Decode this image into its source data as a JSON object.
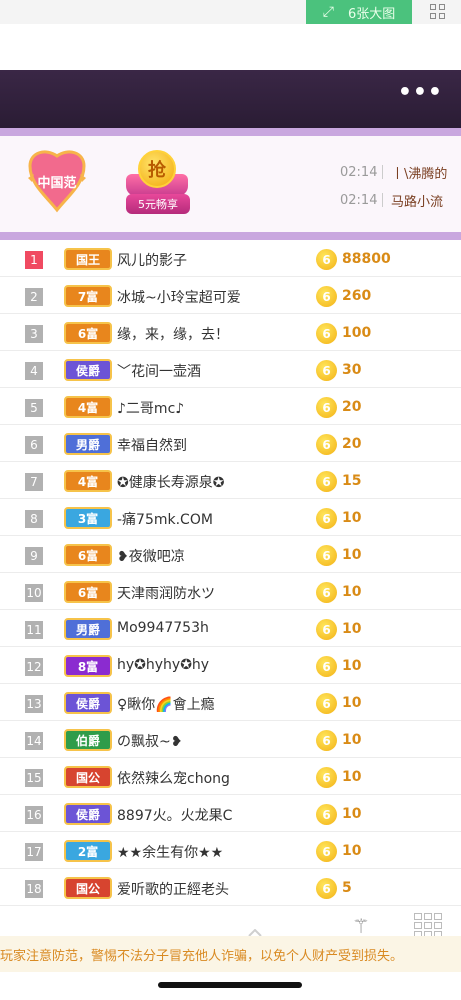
{
  "top": {
    "label": "6张大图",
    "expand_icon": "expand-arrows-icon",
    "grid_icon": "grid-icon"
  },
  "header": {
    "more_icon": "more-dots-icon",
    "more_symbol": "•••"
  },
  "banner": {
    "badge_text": "中国范",
    "grab_char": "抢",
    "grab_label": "5元畅享",
    "news": [
      {
        "time": "02:14",
        "text": "丨\\沸腾的"
      },
      {
        "time": "02:14",
        "text": "马路小流"
      }
    ]
  },
  "ranking": [
    {
      "rank": "1",
      "badge": "国王",
      "badge_color": "#e8861d",
      "name": "风儿的影子",
      "amount": "88800"
    },
    {
      "rank": "2",
      "badge": "7富",
      "badge_color": "#e8861d",
      "name": "冰城~小玲宝超可爱",
      "amount": "260"
    },
    {
      "rank": "3",
      "badge": "6富",
      "badge_color": "#e8861d",
      "name": "缘，来，缘，去！",
      "amount": "100"
    },
    {
      "rank": "4",
      "badge": "侯爵",
      "badge_color": "#6c54d6",
      "name": "﹀花间一壶酒",
      "amount": "30"
    },
    {
      "rank": "5",
      "badge": "4富",
      "badge_color": "#e8861d",
      "name": "♪二哥mc♪",
      "amount": "20"
    },
    {
      "rank": "6",
      "badge": "男爵",
      "badge_color": "#4f6fd8",
      "name": "幸福自然到",
      "amount": "20"
    },
    {
      "rank": "7",
      "badge": "4富",
      "badge_color": "#e8861d",
      "name": "✪健康长寿源泉✪",
      "amount": "15"
    },
    {
      "rank": "8",
      "badge": "3富",
      "badge_color": "#3aa7e0",
      "name": "-痛75mk.COM",
      "amount": "10"
    },
    {
      "rank": "9",
      "badge": "6富",
      "badge_color": "#e8861d",
      "name": "❥夜微吧凉",
      "amount": "10"
    },
    {
      "rank": "10",
      "badge": "6富",
      "badge_color": "#e8861d",
      "name": "天津雨润防水ツ",
      "amount": "10"
    },
    {
      "rank": "11",
      "badge": "男爵",
      "badge_color": "#4f6fd8",
      "name": "Mo9947753h",
      "amount": "10"
    },
    {
      "rank": "12",
      "badge": "8富",
      "badge_color": "#8b2bd0",
      "name": "hy✪hyhy✪hy",
      "amount": "10"
    },
    {
      "rank": "13",
      "badge": "侯爵",
      "badge_color": "#6c54d6",
      "name": "♀瞅你🌈會上瘾",
      "amount": "10"
    },
    {
      "rank": "14",
      "badge": "伯爵",
      "badge_color": "#2f9c4a",
      "name": "の飘叔~❥",
      "amount": "10"
    },
    {
      "rank": "15",
      "badge": "国公",
      "badge_color": "#d7442f",
      "name": "依然辣么宠chong",
      "amount": "10"
    },
    {
      "rank": "16",
      "badge": "侯爵",
      "badge_color": "#6c54d6",
      "name": "8897火。火龙果C",
      "amount": "10"
    },
    {
      "rank": "17",
      "badge": "2富",
      "badge_color": "#3aa7e0",
      "name": "★★余生有你★★",
      "amount": "10"
    },
    {
      "rank": "18",
      "badge": "国公",
      "badge_color": "#d7442f",
      "name": "爱听歌的正經老头",
      "amount": "5"
    }
  ],
  "coin_char": "6",
  "notice": "玩家注意防范，警惕不法分子冒充他人诈骗，以免个人财产受到损失。",
  "footer": {
    "wand_icon": "magic-wand-icon",
    "grid_icon": "grid-icon"
  }
}
